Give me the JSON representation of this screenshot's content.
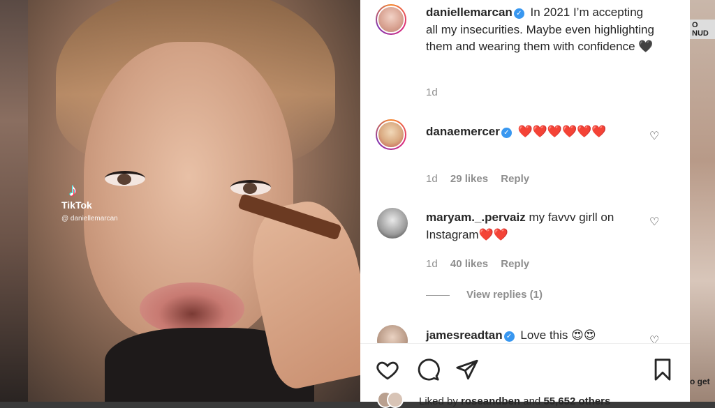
{
  "background": {
    "right_label": "O NUD",
    "right_bottom": "o get"
  },
  "media": {
    "tiktok_label": "TikTok",
    "tiktok_user": "@ daniellemarcan"
  },
  "post": {
    "author": "daniellemarcan",
    "caption": "In 2021 I’m accepting all my insecurities. Maybe even highlighting them and wearing them with confidence 🖤",
    "time": "1d"
  },
  "comments": [
    {
      "user": "danaemercer",
      "verified": true,
      "text": "❤️❤️❤️❤️❤️❤️",
      "time": "1d",
      "likes": "29 likes",
      "reply": "Reply"
    },
    {
      "user": "maryam._.pervaiz",
      "verified": false,
      "text": "my favvv girll on Instagram❤️❤️",
      "time": "1d",
      "likes": "40 likes",
      "reply": "Reply"
    },
    {
      "user": "jamesreadtan",
      "verified": true,
      "text": "Love this 😍😍"
    }
  ],
  "view_replies": "View replies (1)",
  "liked_by": {
    "prefix": "Liked by",
    "user": "roseandben",
    "middle": "and",
    "count": "55,652 others"
  },
  "icons": {
    "like": "heart-outline-icon",
    "comment": "comment-bubble-icon",
    "share": "paper-plane-icon",
    "save": "bookmark-icon"
  }
}
